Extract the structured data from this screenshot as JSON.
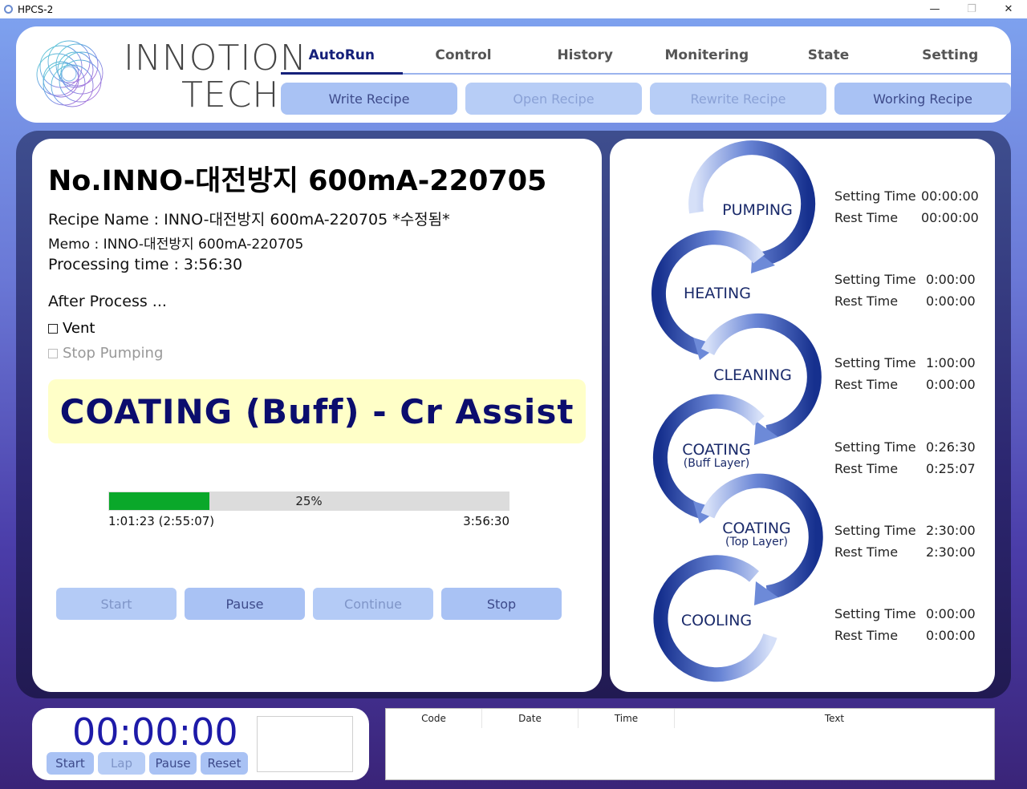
{
  "window": {
    "title": "HPCS-2",
    "controls": [
      "minimize",
      "restore",
      "close"
    ]
  },
  "logo": {
    "line1": "INNOTION",
    "line2": "TECH"
  },
  "tabs": [
    {
      "label": "AutoRun",
      "active": true
    },
    {
      "label": "Control",
      "active": false
    },
    {
      "label": "History",
      "active": false
    },
    {
      "label": "Monitering",
      "active": false
    },
    {
      "label": "State",
      "active": false
    },
    {
      "label": "Setting",
      "active": false
    }
  ],
  "sub_buttons": [
    {
      "label": "Write Recipe",
      "enabled": true
    },
    {
      "label": "Open Recipe",
      "enabled": false
    },
    {
      "label": "Rewrite Recipe",
      "enabled": false
    },
    {
      "label": "Working Recipe",
      "enabled": true
    }
  ],
  "recipe": {
    "title": "No.INNO-대전방지 600mA-220705",
    "name_line": "Recipe Name : INNO-대전방지 600mA-220705 *수정됨*",
    "memo_line": "Memo : INNO-대전방지 600mA-220705",
    "processing_time_line": "Processing time : 3:56:30",
    "after_process_label": "After Process ...",
    "options": [
      {
        "label": "Vent",
        "checked": false,
        "enabled": true
      },
      {
        "label": "Stop Pumping",
        "checked": false,
        "enabled": false
      }
    ]
  },
  "status": {
    "current_step": "COATING (Buff) - Cr Assist"
  },
  "progress": {
    "percent_label": "25%",
    "fraction": 0.25,
    "elapsed": "1:01:23",
    "remaining": "(2:55:07)",
    "total": "3:56:30"
  },
  "control_buttons": [
    {
      "label": "Start",
      "enabled": false
    },
    {
      "label": "Pause",
      "enabled": true
    },
    {
      "label": "Continue",
      "enabled": false
    },
    {
      "label": "Stop",
      "enabled": true
    }
  ],
  "process_steps": [
    {
      "name": "PUMPING",
      "sub": "",
      "setting_label": "Setting Time",
      "setting_time": "00:00:00",
      "rest_label": "Rest Time",
      "rest_time": "00:00:00"
    },
    {
      "name": "HEATING",
      "sub": "",
      "setting_label": "Setting Time",
      "setting_time": "0:00:00",
      "rest_label": "Rest Time",
      "rest_time": "0:00:00"
    },
    {
      "name": "CLEANING",
      "sub": "",
      "setting_label": "Setting Time",
      "setting_time": "1:00:00",
      "rest_label": "Rest Time",
      "rest_time": "0:00:00"
    },
    {
      "name": "COATING",
      "sub": "(Buff Layer)",
      "setting_label": "Setting Time",
      "setting_time": "0:26:30",
      "rest_label": "Rest Time",
      "rest_time": "0:25:07"
    },
    {
      "name": "COATING",
      "sub": "(Top Layer)",
      "setting_label": "Setting Time",
      "setting_time": "2:30:00",
      "rest_label": "Rest Time",
      "rest_time": "2:30:00"
    },
    {
      "name": "COOLING",
      "sub": "",
      "setting_label": "Setting Time",
      "setting_time": "0:00:00",
      "rest_label": "Rest Time",
      "rest_time": "0:00:00"
    }
  ],
  "stopwatch": {
    "time": "00:00:00",
    "buttons": [
      {
        "label": "Start",
        "enabled": true
      },
      {
        "label": "Lap",
        "enabled": false
      },
      {
        "label": "Pause",
        "enabled": true
      },
      {
        "label": "Reset",
        "enabled": true
      }
    ]
  },
  "log_table": {
    "columns": [
      "Code",
      "Date",
      "Time",
      "Text"
    ],
    "rows": []
  },
  "colors": {
    "accent_dark": "#15207a",
    "button_bg": "#a9c2f4",
    "progress_fill": "#0aa82a",
    "status_banner_bg": "#ffffc8",
    "status_text": "#0b0d6e",
    "stopwatch_text": "#1d1aa8"
  }
}
